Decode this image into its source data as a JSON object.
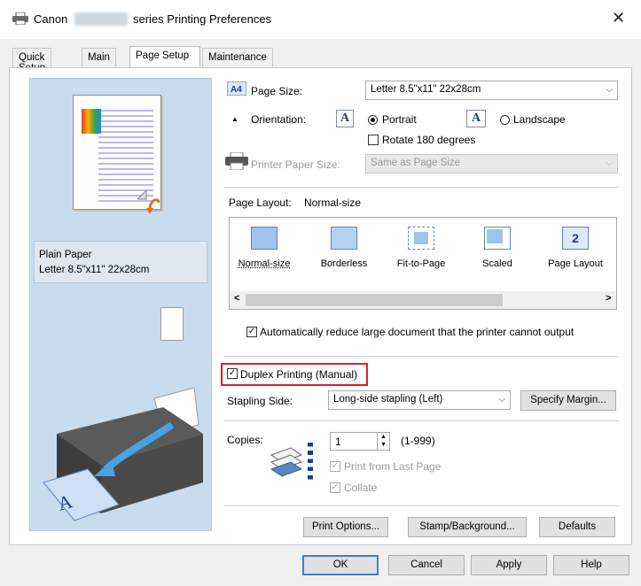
{
  "window": {
    "title_brand": "Canon",
    "title_rest": "series Printing Preferences",
    "close_glyph": "✕"
  },
  "tabs": [
    {
      "label": "Quick Setup"
    },
    {
      "label": "Main"
    },
    {
      "label": "Page Setup",
      "active": true
    },
    {
      "label": "Maintenance"
    }
  ],
  "preview": {
    "media_type": "Plain Paper",
    "media_size": "Letter 8.5\"x11\" 22x28cm"
  },
  "page_size": {
    "label": "Page Size:",
    "value": "Letter 8.5\"x11\" 22x28cm"
  },
  "orientation": {
    "label": "Orientation:",
    "portrait": "Portrait",
    "landscape": "Landscape",
    "selected": "Portrait",
    "rotate_label": "Rotate 180 degrees",
    "icon_letter": "A"
  },
  "printer_paper_size": {
    "label": "Printer Paper Size:",
    "value": "Same as Page Size"
  },
  "page_layout": {
    "label": "Page Layout:",
    "value": "Normal-size",
    "items": [
      {
        "label": "Normal-size",
        "icon": "normal-size-icon"
      },
      {
        "label": "Borderless",
        "icon": "borderless-icon"
      },
      {
        "label": "Fit-to-Page",
        "icon": "fit-to-page-icon"
      },
      {
        "label": "Scaled",
        "icon": "scaled-icon"
      },
      {
        "label": "Page Layout",
        "icon": "page-layout-icon",
        "glyph": "2"
      }
    ],
    "scroll_left": "<",
    "scroll_right": ">"
  },
  "auto_reduce": {
    "label": "Automatically reduce large document that the printer cannot output",
    "checked": true
  },
  "duplex": {
    "label": "Duplex Printing (Manual)",
    "checked": true
  },
  "stapling": {
    "label": "Stapling Side:",
    "value": "Long-side stapling (Left)",
    "margin_button": "Specify Margin..."
  },
  "copies": {
    "label": "Copies:",
    "value": "1",
    "range": "(1-999)",
    "print_last": "Print from Last Page",
    "collate": "Collate"
  },
  "buttons": {
    "print_options": "Print Options...",
    "stamp_background": "Stamp/Background...",
    "defaults": "Defaults",
    "ok": "OK",
    "cancel": "Cancel",
    "apply": "Apply",
    "help": "Help"
  },
  "colors": {
    "accent": "#3c7fd1",
    "highlight": "#e02020",
    "preview_bg": "#c9dcee"
  }
}
